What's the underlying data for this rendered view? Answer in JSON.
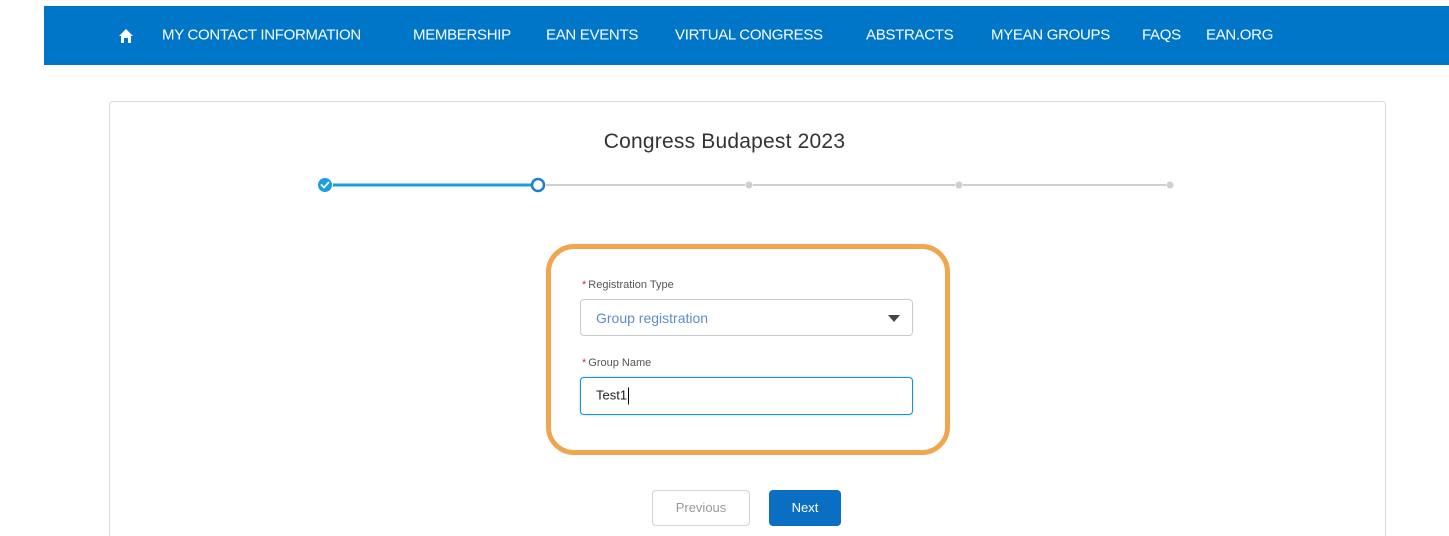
{
  "nav": {
    "home_icon": "home-icon",
    "items": [
      {
        "label": "MY CONTACT INFORMATION"
      },
      {
        "label": "MEMBERSHIP"
      },
      {
        "label": "EAN EVENTS"
      },
      {
        "label": "VIRTUAL CONGRESS"
      },
      {
        "label": "ABSTRACTS"
      },
      {
        "label": "MYEAN GROUPS"
      },
      {
        "label": "FAQS"
      },
      {
        "label": "EAN.ORG"
      }
    ]
  },
  "wizard": {
    "title": "Congress Budapest 2023",
    "steps": [
      {
        "status": "complete"
      },
      {
        "status": "current"
      },
      {
        "status": "upcoming"
      },
      {
        "status": "upcoming"
      },
      {
        "status": "upcoming"
      }
    ]
  },
  "form": {
    "registration_type": {
      "required_mark": "*",
      "label": "Registration Type",
      "value": "Group registration"
    },
    "group_name": {
      "required_mark": "*",
      "label": "Group Name",
      "value": "Test1"
    }
  },
  "buttons": {
    "previous": "Previous",
    "next": "Next"
  },
  "colors": {
    "nav_bg": "#0076c8",
    "accent": "#1b8fe0",
    "highlight": "#f0a54e",
    "next_button": "#0a6fc2"
  }
}
